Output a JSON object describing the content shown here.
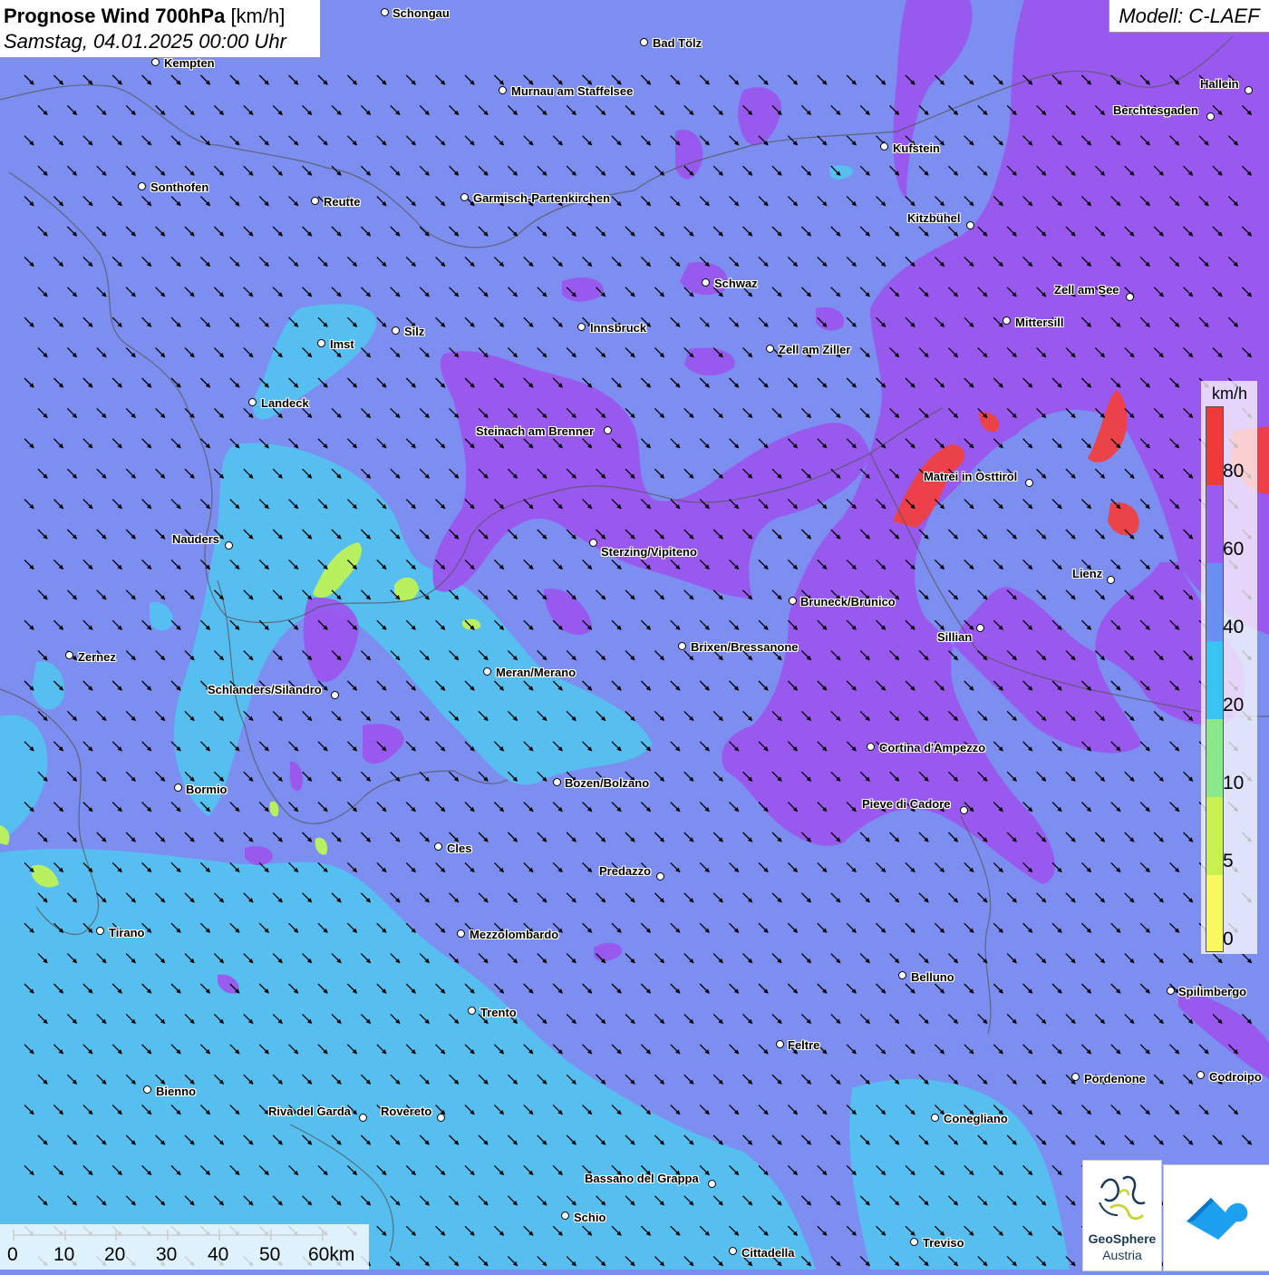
{
  "title": {
    "main": "Prognose Wind 700hPa",
    "unit": "[km/h]",
    "datetime": "Samstag, 04.01.2025 00:00 Uhr"
  },
  "model": "Modell: C-LAEF",
  "legend": {
    "unit": "km/h",
    "labels": [
      "80",
      "60",
      "40",
      "20",
      "10",
      "5",
      "0"
    ],
    "colors": [
      "#f03a3a",
      "#9a5cf0",
      "#6a8ef2",
      "#39c3f2",
      "#8ae88a",
      "#c8f050",
      "#f8f860"
    ]
  },
  "scale": {
    "labels": [
      "0",
      "10",
      "20",
      "30",
      "40",
      "50",
      "60km"
    ]
  },
  "logo": {
    "name": "GeoSphere",
    "sub": "Austria"
  },
  "cities": [
    {
      "name": "Schongau"
    },
    {
      "name": "Bad Tölz"
    },
    {
      "name": "Kempten"
    },
    {
      "name": "Murnau am Staffelsee"
    },
    {
      "name": "Hallein"
    },
    {
      "name": "Berchtesgaden"
    },
    {
      "name": "Kufstein"
    },
    {
      "name": "Sonthofen"
    },
    {
      "name": "Reutte"
    },
    {
      "name": "Garmisch-Partenkirchen"
    },
    {
      "name": "Kitzbühel"
    },
    {
      "name": "Schwaz"
    },
    {
      "name": "Zell am See"
    },
    {
      "name": "Silz"
    },
    {
      "name": "Innsbruck"
    },
    {
      "name": "Mittersill"
    },
    {
      "name": "Imst"
    },
    {
      "name": "Zell am Ziller"
    },
    {
      "name": "Landeck"
    },
    {
      "name": "Steinach am Brenner"
    },
    {
      "name": "Matrei in Osttirol"
    },
    {
      "name": "Nauders"
    },
    {
      "name": "Sterzing/Vipiteno"
    },
    {
      "name": "Lienz"
    },
    {
      "name": "Bruneck/Brunico"
    },
    {
      "name": "Sillian"
    },
    {
      "name": "Zernez"
    },
    {
      "name": "Brixen/Bressanone"
    },
    {
      "name": "Meran/Merano"
    },
    {
      "name": "Schlanders/Silandro"
    },
    {
      "name": "Cortina d'Ampezzo"
    },
    {
      "name": "Bozen/Bolzano"
    },
    {
      "name": "Bormio"
    },
    {
      "name": "Pieve di Cadore"
    },
    {
      "name": "Cles"
    },
    {
      "name": "Predazzo"
    },
    {
      "name": "Tirano"
    },
    {
      "name": "Mezzolombardo"
    },
    {
      "name": "Belluno"
    },
    {
      "name": "Spilimbergo"
    },
    {
      "name": "Trento"
    },
    {
      "name": "Feltre"
    },
    {
      "name": "Bienno"
    },
    {
      "name": "Pordenone"
    },
    {
      "name": "Codroipo"
    },
    {
      "name": "Riva del Garda"
    },
    {
      "name": "Rovereto"
    },
    {
      "name": "Conegliano"
    },
    {
      "name": "Bassano del Grappa"
    },
    {
      "name": "Schio"
    },
    {
      "name": "Treviso"
    },
    {
      "name": "Cittadella"
    }
  ]
}
